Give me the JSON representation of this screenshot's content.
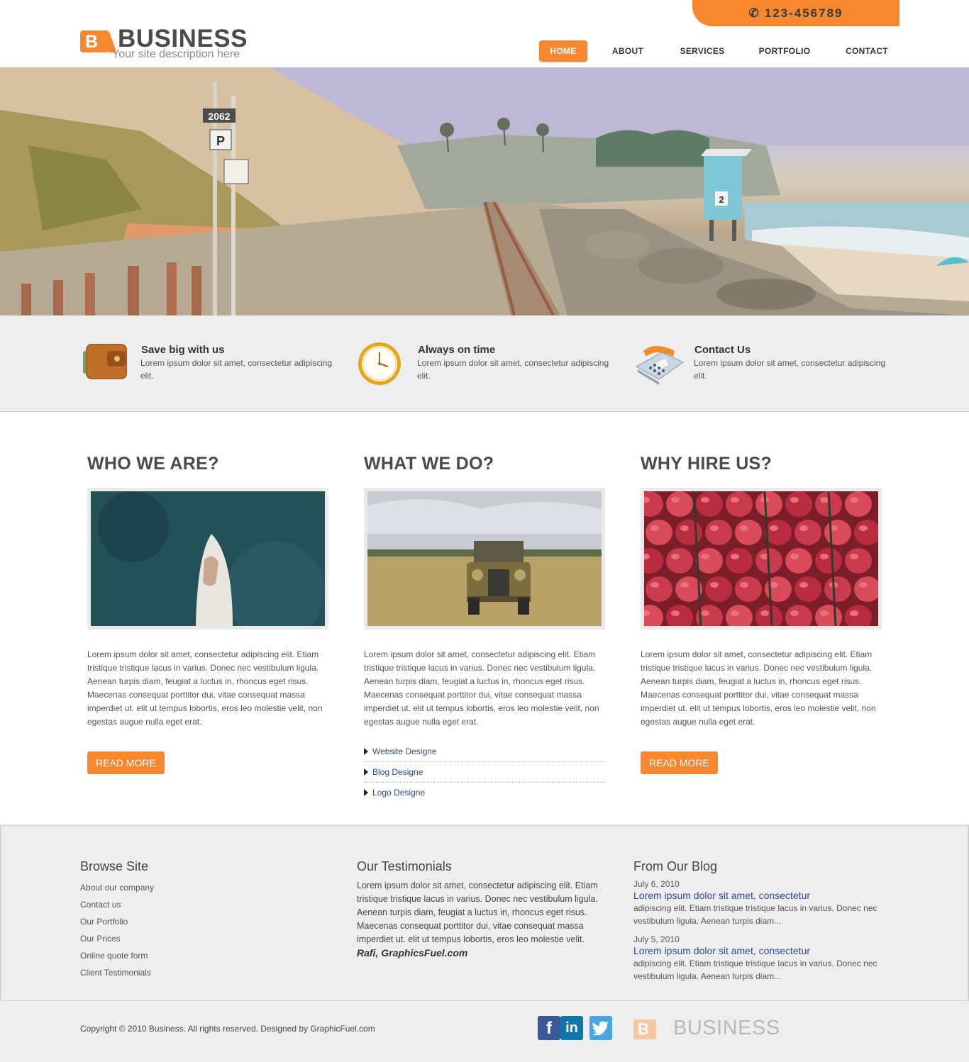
{
  "header": {
    "phone": "123-456789",
    "logo_letter": "B",
    "logo_title": "BUSINESS",
    "logo_subtitle": "Your site description here",
    "nav": [
      {
        "label": "HOME",
        "active": true
      },
      {
        "label": "ABOUT",
        "active": false
      },
      {
        "label": "SERVICES",
        "active": false
      },
      {
        "label": "PORTFOLIO",
        "active": false
      },
      {
        "label": "CONTACT",
        "active": false
      }
    ]
  },
  "hero": {
    "signs": [
      "2062",
      "P",
      "2"
    ]
  },
  "features": [
    {
      "icon": "wallet-icon",
      "title": "Save big with us",
      "text": "Lorem ipsum dolor sit amet, consectetur adipiscing elit."
    },
    {
      "icon": "clock-icon",
      "title": "Always on time",
      "text": "Lorem ipsum dolor sit amet, consectetur adipiscing elit."
    },
    {
      "icon": "telephone-icon",
      "title": "Contact Us",
      "text": "Lorem ipsum dolor sit amet, consectetur adipiscing elit."
    }
  ],
  "columns": [
    {
      "title": "WHO WE ARE?",
      "image": "boat-photo",
      "text": "Lorem ipsum dolor sit amet, consectetur adipiscing elit. Etiam tristique tristique lacus in varius. Donec nec vestibulum ligula. Aenean turpis diam, feugiat a luctus in, rhoncus eget risus. Maecenas consequat porttitor dui, vitae consequat massa imperdiet ut. elit ut tempus lobortis, eros leo molestie velit, non egestas augue nulla eget erat.",
      "button": "READ MORE"
    },
    {
      "title": "WHAT WE DO?",
      "image": "old-truck-photo",
      "text": "Lorem ipsum dolor sit amet, consectetur adipiscing elit. Etiam tristique tristique lacus in varius. Donec nec vestibulum ligula. Aenean turpis diam, feugiat a luctus in, rhoncus eget risus. Maecenas consequat porttitor dui, vitae consequat massa imperdiet ut. elit ut tempus lobortis, eros leo molestie velit, non egestas augue nulla eget erat.",
      "services": [
        "Website Designe",
        "Blog Designe",
        "Logo Designe"
      ]
    },
    {
      "title": "WHY HIRE US?",
      "image": "strawberries-photo",
      "text": "Lorem ipsum dolor sit amet, consectetur adipiscing elit. Etiam tristique tristique lacus in varius. Donec nec vestibulum ligula. Aenean turpis diam, feugiat a luctus in, rhoncus eget risus. Maecenas consequat porttitor dui, vitae consequat massa imperdiet ut. elit ut tempus lobortis, eros leo molestie velit, non egestas augue nulla eget erat.",
      "button": "READ MORE"
    }
  ],
  "footer": {
    "browse": {
      "title": "Browse Site",
      "links": [
        "About our company",
        "Contact us",
        "Our Portfolio",
        "Our Prices",
        "Online quote form",
        "Client Testimonials"
      ]
    },
    "testimonials": {
      "title": "Our Testimonials",
      "text": "Lorem ipsum dolor sit amet, consectetur adipiscing elit. Etiam tristique tristique lacus in varius. Donec nec vestibulum ligula. Aenean turpis diam, feugiat a luctus in, rhoncus eget risus. Maecenas consequat porttitor dui, vitae consequat massa imperdiet ut. elit ut tempus lobortis, eros leo molestie velit.",
      "author": "Rafi, GraphicsFuel.com"
    },
    "blog": {
      "title": "From Our Blog",
      "posts": [
        {
          "date": "July 6, 2010",
          "title": "Lorem ipsum dolor sit amet, consectetur",
          "excerpt": "adipiscing elit. Etiam tristique tristique lacus in varius. Donec nec vestibulum ligula. Aenean turpis diam..."
        },
        {
          "date": "July 5, 2010",
          "title": "Lorem ipsum dolor sit amet, consectetur",
          "excerpt": "adipiscing elit. Etiam tristique tristique lacus in varius. Donec nec vestibulum ligula. Aenean turpis diam..."
        }
      ]
    }
  },
  "bottom": {
    "copyright": "Copyright © 2010 Business. All rights reserved. Designed by GraphicFuel.com",
    "social": [
      {
        "name": "facebook-icon",
        "glyph": "f",
        "color": "#3b5998"
      },
      {
        "name": "linkedin-icon",
        "glyph": "in",
        "color": "#0e76a8"
      },
      {
        "name": "twitter-icon",
        "glyph": "t",
        "color": "#4aa6e0"
      }
    ],
    "logo_letter": "B",
    "logo_title": "BUSINESS"
  },
  "colors": {
    "accent": "#f7882f",
    "link": "#2a4a9a",
    "panel": "#eeeeee"
  }
}
